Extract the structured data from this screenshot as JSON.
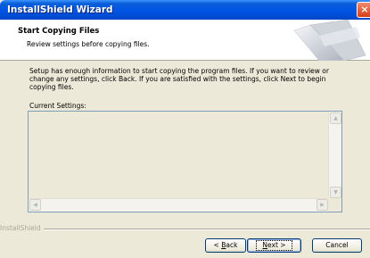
{
  "window": {
    "title": "InstallShield Wizard",
    "close_glyph": "×"
  },
  "header": {
    "title": "Start Copying Files",
    "subtitle": "Review settings before copying files."
  },
  "body": {
    "message": "Setup has enough information to start copying the program files.  If you want to review or change any settings, click Back.  If you are satisfied with the settings, click Next to begin copying files.",
    "current_settings_label": "Current Settings:"
  },
  "brand": "InstallShield",
  "buttons": {
    "back_mnemonic": "B",
    "back_rest": "ack",
    "back_prefix": "< ",
    "next_mnemonic": "N",
    "next_rest": "ext >",
    "cancel": "Cancel"
  },
  "icons": {
    "scroll_up": "▲",
    "scroll_down": "▼",
    "scroll_left": "◀",
    "scroll_right": "▶"
  },
  "colors": {
    "titlebar": "#0054e3",
    "dialog_bg": "#ece9d8",
    "header_bg": "#ffffff"
  }
}
